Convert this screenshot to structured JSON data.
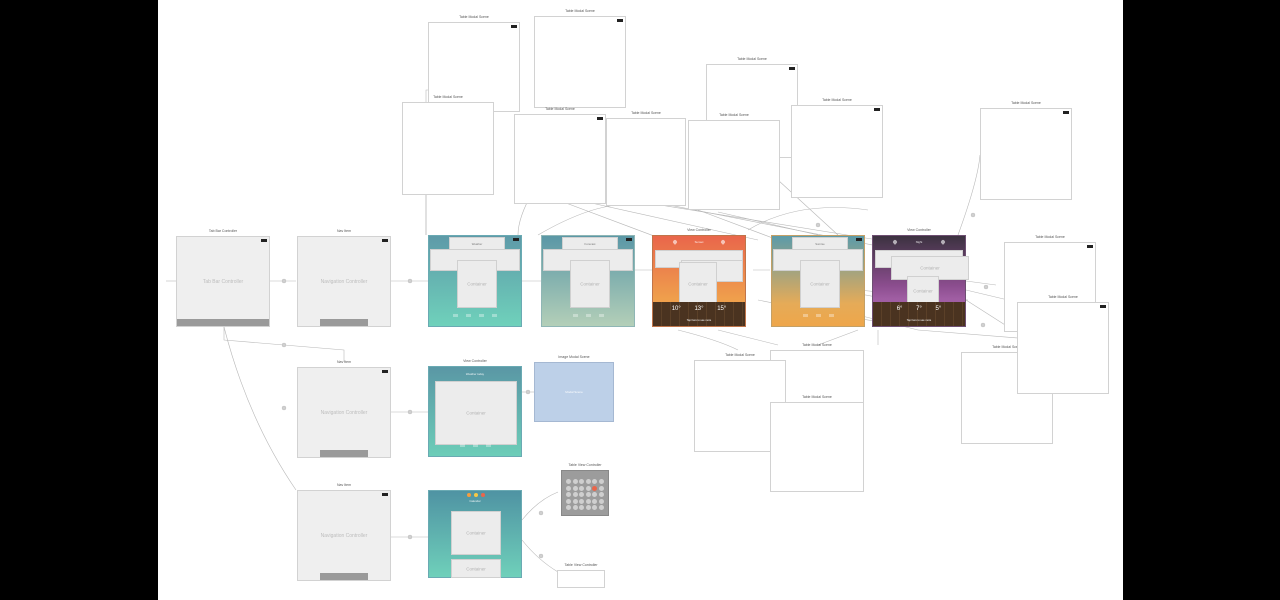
{
  "storyboard": {
    "labels": {
      "tab_bar_controller": "Tab Bar Controller",
      "navigation_controller": "Navigation Controller",
      "container": "Container",
      "view_controller": "View Controller",
      "table_view_controller": "Table View Controller",
      "modal_scene": "Modal Scene"
    },
    "scenes": {
      "tab_bar": {
        "title": "Tab Bar Controller",
        "label": "Tab Bar Controller"
      },
      "nav_1": {
        "title": "Nav Item",
        "label": "Navigation Controller"
      },
      "nav_2": {
        "title": "Nav Item",
        "label": "Navigation Controller"
      },
      "nav_3": {
        "title": "Nav Item",
        "label": "Navigation Controller"
      },
      "weather_1": {
        "title": "View Controller",
        "nav": "Weather",
        "label": "Container"
      },
      "weather_2": {
        "title": "View Controller",
        "nav": "Forecast",
        "label": "Container"
      },
      "weather_3": {
        "title": "View Controller",
        "nav": "Sunset",
        "label": "Container",
        "temps": [
          "10°",
          "13°",
          "15°"
        ],
        "note": "Tap here to see more"
      },
      "weather_4": {
        "title": "View Controller",
        "nav": "Sunrise",
        "label": "Container"
      },
      "weather_5": {
        "title": "View Controller",
        "nav": "Night",
        "label": "Container",
        "temps": [
          "6°",
          "7°",
          "5°"
        ],
        "note": "Tap here to see more"
      },
      "mid_vc": {
        "title": "View Controller",
        "nav": "Weather today",
        "label": "Container"
      },
      "blue_modal": {
        "title": "Image Modal Scene",
        "label": "Modal Scene"
      },
      "bottom_vc": {
        "title": "View Controller",
        "nav": "Calendar",
        "label": "Container",
        "label2": "Container"
      },
      "calendar": {
        "title": "Table View Controller"
      },
      "table_small": {
        "title": "Table View Controller"
      },
      "white_scene": {
        "title": "Table Modal Scene"
      }
    }
  }
}
